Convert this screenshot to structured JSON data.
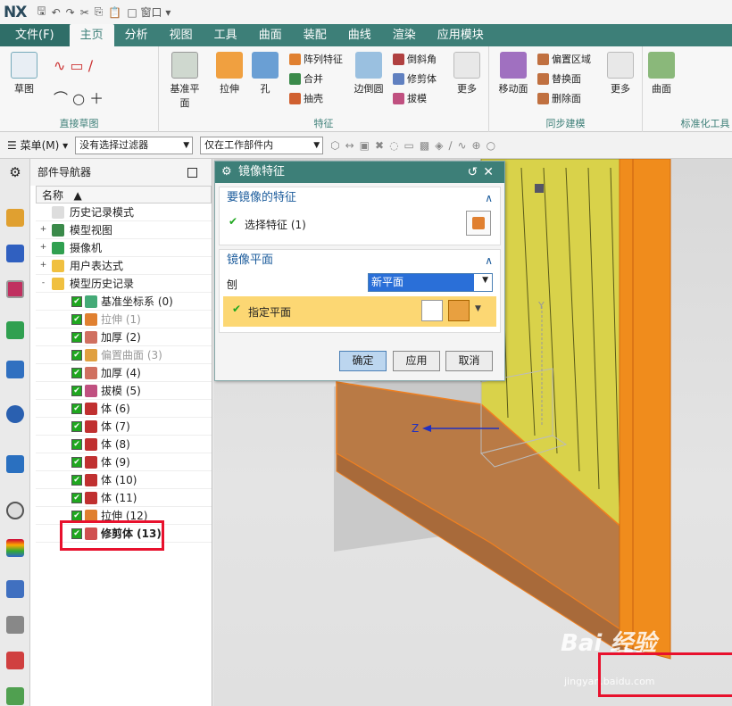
{
  "app": {
    "logo": "NX",
    "window_menu": "窗口"
  },
  "tabs": [
    "文件(F)",
    "主页",
    "分析",
    "视图",
    "工具",
    "曲面",
    "装配",
    "曲线",
    "渲染",
    "应用模块"
  ],
  "ribbon": {
    "sketch": {
      "big": "草图",
      "group": "直接草图"
    },
    "feature": {
      "big": [
        "基准平面",
        "拉伸",
        "孔",
        "边倒圆",
        "更多"
      ],
      "small": [
        "阵列特征",
        "合并",
        "抽壳",
        "倒斜角",
        "修剪体",
        "拔模"
      ],
      "group": "特征"
    },
    "sync": {
      "big": [
        "移动面",
        "更多"
      ],
      "small": [
        "偏置区域",
        "替换面",
        "删除面"
      ],
      "group": "同步建模"
    },
    "surface": {
      "big": "曲面",
      "group": "标准化工具"
    }
  },
  "cmdbar": {
    "menu": "菜单(M)",
    "filter": "没有选择过滤器",
    "scope": "仅在工作部件内"
  },
  "nav": {
    "title": "部件导航器",
    "col_name": "名称",
    "top": [
      {
        "label": "历史记录模式",
        "expand": ""
      },
      {
        "label": "模型视图",
        "expand": "+"
      },
      {
        "label": "摄像机",
        "expand": "+"
      },
      {
        "label": "用户表达式",
        "expand": "+"
      },
      {
        "label": "模型历史记录",
        "expand": "-"
      }
    ],
    "history": [
      {
        "label": "基准坐标系 (0)",
        "state": "normal",
        "color": "#4a7"
      },
      {
        "label": "拉伸 (1)",
        "state": "dim",
        "color": "#e08030"
      },
      {
        "label": "加厚 (2)",
        "state": "normal",
        "color": "#d07060"
      },
      {
        "label": "偏置曲面 (3)",
        "state": "dim",
        "color": "#e0a040"
      },
      {
        "label": "加厚 (4)",
        "state": "normal",
        "color": "#d07060"
      },
      {
        "label": "拔模 (5)",
        "state": "normal",
        "color": "#c05080"
      },
      {
        "label": "体 (6)",
        "state": "normal",
        "color": "#c03030"
      },
      {
        "label": "体 (7)",
        "state": "normal",
        "color": "#c03030"
      },
      {
        "label": "体 (8)",
        "state": "normal",
        "color": "#c03030"
      },
      {
        "label": "体 (9)",
        "state": "normal",
        "color": "#c03030"
      },
      {
        "label": "体 (10)",
        "state": "normal",
        "color": "#c03030"
      },
      {
        "label": "体 (11)",
        "state": "normal",
        "color": "#c03030"
      },
      {
        "label": "拉伸 (12)",
        "state": "normal",
        "color": "#e08030"
      },
      {
        "label": "修剪体 (13)",
        "state": "bold",
        "color": "#d05050"
      }
    ]
  },
  "dialog": {
    "title": "镜像特征",
    "sec1": {
      "header": "要镜像的特征",
      "item": "选择特征 (1)"
    },
    "sec2": {
      "header": "镜像平面",
      "plane_label": "刨",
      "plane_value": "新平面",
      "specify": "指定平面"
    },
    "ok": "确定",
    "apply": "应用",
    "cancel": "取消"
  },
  "watermark": {
    "brand": "Bai 经验",
    "url": "jingyan.baidu.com"
  },
  "axis": {
    "z": "Z",
    "y": "Y"
  }
}
